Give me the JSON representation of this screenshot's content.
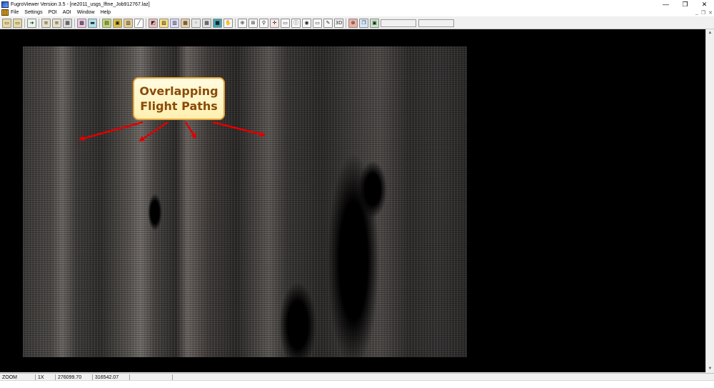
{
  "window": {
    "title": "FugroViewer Version 3.5 - [ne2011_usgs_lftne_Job912767.laz]",
    "controls": [
      "—",
      "❐",
      "✕"
    ]
  },
  "menu": {
    "items": [
      "File",
      "Settings",
      "POI",
      "AOI",
      "Window",
      "Help"
    ],
    "mdi_controls": [
      "_",
      "❐",
      "✕"
    ]
  },
  "toolbar": {
    "buttons": [
      {
        "icon": "open-folder-icon",
        "color": "#e8d9a0",
        "glyph": "▭"
      },
      {
        "icon": "open-file-icon",
        "color": "#e8d9a0",
        "glyph": "▭"
      },
      {
        "icon": "forward-arrow-icon",
        "color": "#e8f5e8",
        "glyph": "➜"
      },
      {
        "icon": "layers-icon",
        "color": "#e8e0c8",
        "glyph": "≡"
      },
      {
        "icon": "layers-alt-icon",
        "color": "#e8e0c8",
        "glyph": "≡"
      },
      {
        "icon": "grid-points-icon",
        "color": "#dcdcdc",
        "glyph": "▦"
      },
      {
        "icon": "hatch-icon",
        "color": "#f0c8e8",
        "glyph": "▩"
      },
      {
        "icon": "profile-icon",
        "color": "#b0e0e8",
        "glyph": "▬"
      },
      {
        "icon": "color-ramp-icon",
        "color": "#c0d870",
        "glyph": "▤"
      },
      {
        "icon": "elevation-icon",
        "color": "#e0c040",
        "glyph": "▣"
      },
      {
        "icon": "intensity-icon",
        "color": "#e8d090",
        "glyph": "▥"
      },
      {
        "icon": "line-tool-icon",
        "color": "#ffffff",
        "glyph": "╱"
      },
      {
        "icon": "rgb-icon",
        "color": "#f0c0c0",
        "glyph": "◩"
      },
      {
        "icon": "classification-icon",
        "color": "#ffe080",
        "glyph": "▨"
      },
      {
        "icon": "spectrum-icon",
        "color": "#e0e0ff",
        "glyph": "▥"
      },
      {
        "icon": "palette-icon",
        "color": "#f0d0a0",
        "glyph": "▦"
      },
      {
        "icon": "dots-icon",
        "color": "#e8e8e8",
        "glyph": "⁘"
      },
      {
        "icon": "matrix-icon",
        "color": "#e0e0e0",
        "glyph": "▦"
      },
      {
        "icon": "surface-icon",
        "color": "#3ea8b8",
        "glyph": "■"
      },
      {
        "icon": "pan-hand-icon",
        "color": "#f8f8f8",
        "glyph": "✋"
      },
      {
        "icon": "zoom-icon",
        "color": "#f8f8f8",
        "glyph": "⊕"
      },
      {
        "icon": "zoom-fit-icon",
        "color": "#f8f8f8",
        "glyph": "⊞"
      },
      {
        "icon": "marker-icon",
        "color": "#f8f8f8",
        "glyph": "⚲"
      },
      {
        "icon": "crosshair-icon",
        "color": "#f8e8e8",
        "glyph": "✛"
      },
      {
        "icon": "measure-icon",
        "color": "#f8f8f8",
        "glyph": "▭"
      },
      {
        "icon": "identify-icon",
        "color": "#f8f8f8",
        "glyph": "ⓘ"
      },
      {
        "icon": "search-point-icon",
        "color": "#f8f8f8",
        "glyph": "◉"
      },
      {
        "icon": "ruler-icon",
        "color": "#f8f8f8",
        "glyph": "▭"
      },
      {
        "icon": "pencil-icon",
        "color": "#f8f8f8",
        "glyph": "✎"
      },
      {
        "icon": "3d-view-icon",
        "color": "#f8f8f8",
        "glyph": "3D"
      },
      {
        "icon": "stop-icon",
        "color": "#f0b0a0",
        "glyph": "⊗"
      },
      {
        "icon": "copy-window-icon",
        "color": "#d8e8f8",
        "glyph": "❐"
      },
      {
        "icon": "export-icon",
        "color": "#c8e8c8",
        "glyph": "▣"
      }
    ],
    "separator_after": [
      1,
      2,
      5,
      7,
      11,
      19,
      29
    ]
  },
  "annotation": {
    "callout_line1": "Overlapping",
    "callout_line2": "Flight Paths",
    "arrow_color": "#e00000"
  },
  "statusbar": {
    "mode": "ZOOM",
    "scale": "1X",
    "x": "276099.70",
    "y": "316542.07"
  }
}
